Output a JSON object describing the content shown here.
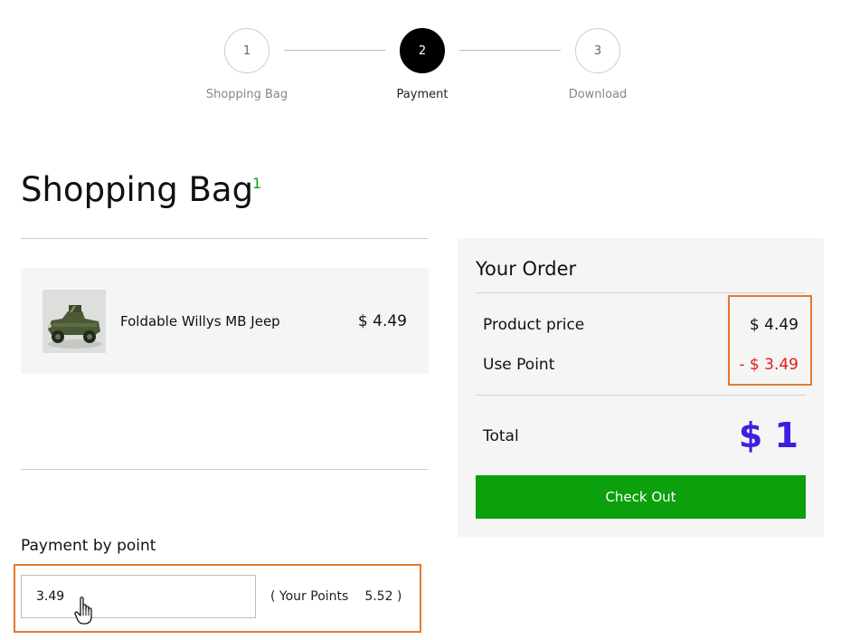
{
  "stepper": {
    "steps": [
      {
        "number": "1",
        "label": "Shopping Bag",
        "active": false
      },
      {
        "number": "2",
        "label": "Payment",
        "active": true
      },
      {
        "number": "3",
        "label": "Download",
        "active": false
      }
    ]
  },
  "bag": {
    "title": "Shopping Bag",
    "count": "1",
    "items": [
      {
        "name": "Foldable Willys MB Jeep",
        "price": "$ 4.49",
        "thumbnail_icon": "jeep-thumbnail"
      }
    ]
  },
  "points": {
    "label": "Payment by point",
    "input_value": "3.49",
    "your_points_label": "( Your Points",
    "your_points_value": "5.52 )"
  },
  "order": {
    "title": "Your Order",
    "product_price_label": "Product price",
    "product_price_value": "$ 4.49",
    "use_point_label": "Use Point",
    "use_point_value": "- $ 3.49",
    "total_label": "Total",
    "total_value": "$ 1",
    "checkout_label": "Check Out"
  },
  "colors": {
    "accent_green": "#0ca00c",
    "discount_red": "#e01b1b",
    "total_blue": "#3c1fe0",
    "highlight_orange": "#e07a30"
  }
}
